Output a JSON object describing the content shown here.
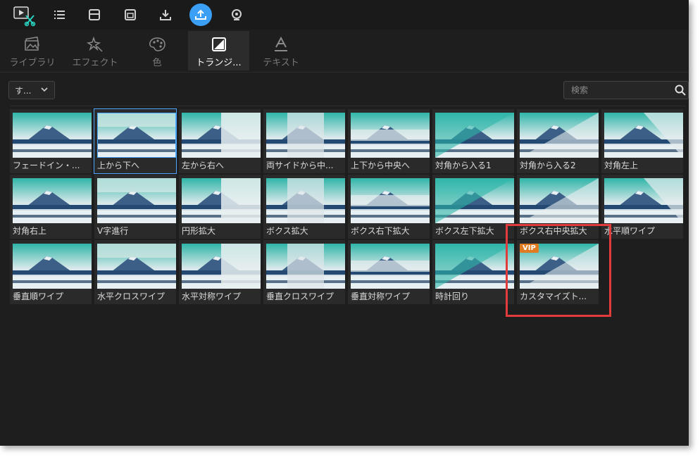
{
  "toolbar": {
    "icons": [
      "app-logo-icon",
      "list-icon",
      "layout-icon",
      "window-icon",
      "download-icon",
      "upload-icon",
      "webcam-icon"
    ],
    "accent": "#3a9ff5"
  },
  "tabs": [
    {
      "label": "ライブラリ",
      "icon": "photos-icon"
    },
    {
      "label": "エフェクト",
      "icon": "sparkle-icon"
    },
    {
      "label": "色",
      "icon": "palette-icon"
    },
    {
      "label": "トランジ...",
      "icon": "transition-icon",
      "active": true
    },
    {
      "label": "テキスト",
      "icon": "text-icon"
    }
  ],
  "filter": {
    "selected": "す..."
  },
  "search": {
    "placeholder": "検索"
  },
  "transitions": [
    {
      "label": "フェードイン・..."
    },
    {
      "label": "上から下へ",
      "selected": true
    },
    {
      "label": "左から右へ"
    },
    {
      "label": "両サイドから中..."
    },
    {
      "label": "上下から中央へ"
    },
    {
      "label": "対角から入る1"
    },
    {
      "label": "対角から入る2"
    },
    {
      "label": "対角左上"
    },
    {
      "label": "対角右上"
    },
    {
      "label": "V字進行"
    },
    {
      "label": "円形拡大"
    },
    {
      "label": "ボクス拡大"
    },
    {
      "label": "ボクス右下拡大"
    },
    {
      "label": "ボクス左下拡大"
    },
    {
      "label": "ボクス右中央拡大"
    },
    {
      "label": "水平順ワイプ"
    },
    {
      "label": "垂直順ワイプ"
    },
    {
      "label": "水平クロスワイプ"
    },
    {
      "label": "水平対称ワイプ"
    },
    {
      "label": "垂直クロスワイプ"
    },
    {
      "label": "垂直対称ワイプ"
    },
    {
      "label": "時計回り"
    },
    {
      "label": "カスタマイズト...",
      "vip": "VIP"
    }
  ],
  "highlight_color": "#e23b3b"
}
